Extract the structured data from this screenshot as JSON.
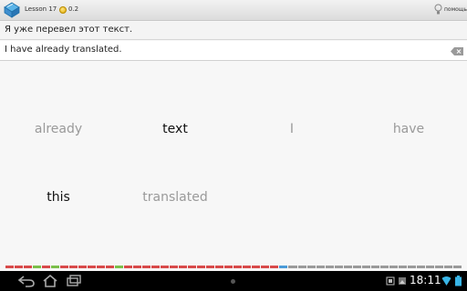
{
  "header": {
    "lesson_label": "Lesson 17",
    "score": "0.2",
    "help_label": "помощь"
  },
  "exercise": {
    "source_sentence": "Я уже перевел этот текст.",
    "answer_text": "I have already translated."
  },
  "word_bank": [
    {
      "word": "already",
      "used": true
    },
    {
      "word": "text",
      "used": false
    },
    {
      "word": "I",
      "used": true
    },
    {
      "word": "have",
      "used": true
    },
    {
      "word": "this",
      "used": false
    },
    {
      "word": "translated",
      "used": true
    }
  ],
  "progress": {
    "total_segments": 50,
    "segment_colors": [
      "#d84a4a",
      "#d84a4a",
      "#d84a4a",
      "#7bbf4a",
      "#d84a4a",
      "#7bbf4a",
      "#d84a4a",
      "#d84a4a",
      "#d84a4a",
      "#d84a4a",
      "#d84a4a",
      "#d84a4a",
      "#7bbf4a",
      "#d84a4a",
      "#d84a4a",
      "#d84a4a",
      "#d84a4a",
      "#d84a4a",
      "#d84a4a",
      "#d84a4a",
      "#d84a4a",
      "#d84a4a",
      "#d84a4a",
      "#d84a4a",
      "#d84a4a",
      "#d84a4a",
      "#d84a4a",
      "#d84a4a",
      "#d84a4a",
      "#d84a4a",
      "#4a9bd8",
      "#9a9a9a",
      "#9a9a9a",
      "#9a9a9a",
      "#9a9a9a",
      "#9a9a9a",
      "#9a9a9a",
      "#9a9a9a",
      "#9a9a9a",
      "#9a9a9a",
      "#9a9a9a",
      "#9a9a9a",
      "#9a9a9a",
      "#9a9a9a",
      "#9a9a9a",
      "#9a9a9a",
      "#9a9a9a",
      "#9a9a9a",
      "#9a9a9a",
      "#9a9a9a"
    ]
  },
  "system_bar": {
    "time": "18:11",
    "icons": [
      "back-icon",
      "home-icon",
      "recent-apps-icon",
      "screenshot-icon",
      "gallery-icon",
      "wifi-icon",
      "battery-icon"
    ]
  }
}
